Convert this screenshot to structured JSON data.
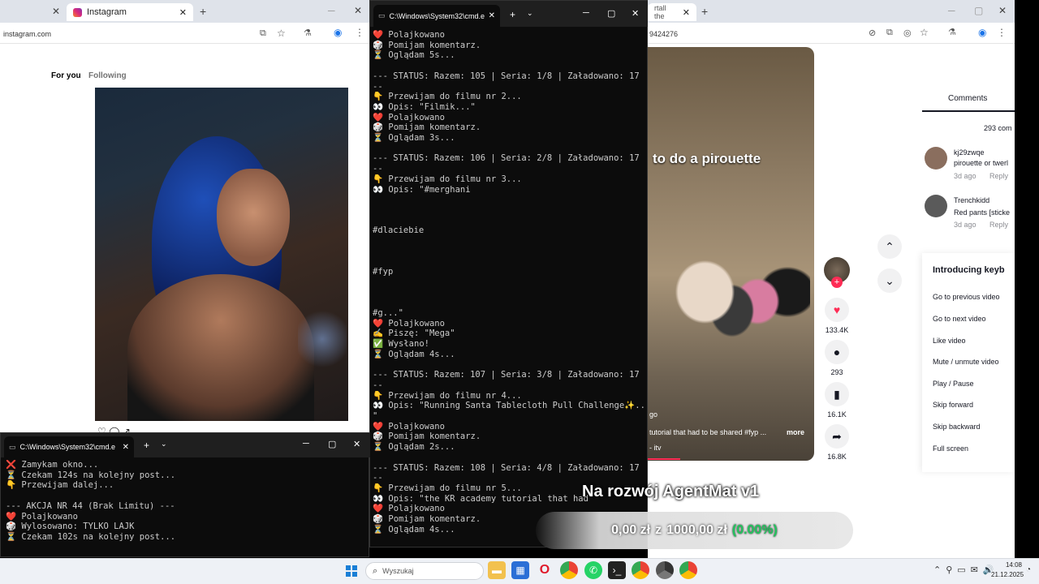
{
  "browser_left": {
    "tab_title": "Instagram",
    "url": "instagram.com",
    "feed_tabs": [
      "For you",
      "Following"
    ]
  },
  "browser_right": {
    "tab_title": "rtall the",
    "url": "9424276"
  },
  "tiktok": {
    "caption_overlay": "to do a pirouette",
    "desc": "tutorial that had to be shared #fyp ...",
    "more": "more",
    "desc_prefix": "go",
    "author": "- itv",
    "likes": "133.4K",
    "comments": "293",
    "saves": "16.1K",
    "shares": "16.8K",
    "comments_tab": "Comments",
    "comments_count": "293 com",
    "comment_list": [
      {
        "user": "kj29zwqe",
        "text": "pirouette or twerl",
        "date": "3d ago",
        "reply": "Reply"
      },
      {
        "user": "Trenchkidd",
        "text": "Red pants [sticke",
        "date": "3d ago",
        "reply": "Reply"
      }
    ],
    "kb_title": "Introducing keyb",
    "kb_items": [
      "Go to previous video",
      "Go to next video",
      "Like video",
      "Mute / unmute video",
      "Play / Pause",
      "Skip forward",
      "Skip backward",
      "Full screen"
    ]
  },
  "cmd_main": {
    "title": "C:\\Windows\\System32\\cmd.e",
    "output": "❤️ Polajkowano\n🎲 Pomijam komentarz.\n⏳ Oglądam 5s...\n\n--- STATUS: Razem: 105 | Seria: 1/8 | Załadowano: 17 -\n--\n👇 Przewijam do filmu nr 2...\n👀 Opis: \"Filmik...\"\n❤️ Polajkowano\n🎲 Pomijam komentarz.\n⏳ Oglądam 3s...\n\n--- STATUS: Razem: 106 | Seria: 2/8 | Załadowano: 17 -\n--\n👇 Przewijam do filmu nr 3...\n👀 Opis: \"#merghani\n\n\n\n#dlaciebie\n\n\n\n#fyp\n\n\n\n#g...\"\n❤️ Polajkowano\n✍️ Piszę: \"Mega\"\n✅ Wysłano!\n⏳ Oglądam 4s...\n\n--- STATUS: Razem: 107 | Seria: 3/8 | Załadowano: 17 -\n--\n👇 Przewijam do filmu nr 4...\n👀 Opis: \"Running Santa Tablecloth Pull Challenge✨...\n\"\n❤️ Polajkowano\n🎲 Pomijam komentarz.\n⏳ Oglądam 2s...\n\n--- STATUS: Razem: 108 | Seria: 4/8 | Załadowano: 17 -\n--\n👇 Przewijam do filmu nr 5...\n👀 Opis: \"the KR academy tutorial that had\n❤️ Polajkowano\n🎲 Pomijam komentarz.\n⏳ Oglądam 4s..."
  },
  "cmd_small": {
    "title": "C:\\Windows\\System32\\cmd.e",
    "output": "❌ Zamykam okno...\n⏳ Czekam 124s na kolejny post...\n👇 Przewijam dalej...\n\n--- AKCJA NR 44 (Brak Limitu) ---\n❤️ Polajkowano\n🎲 Wylosowano: TYLKO LAJK\n⏳ Czekam 102s na kolejny post..."
  },
  "overlay": {
    "headline": "Na rozwój AgentMat v1",
    "amount": "0,00 zł",
    "of": "z",
    "goal": "1000,00 zł",
    "pct": "(0.00%)"
  },
  "taskbar": {
    "search": "Wyszukaj",
    "time": "14:08",
    "date": "21.12.2025"
  },
  "colors": {
    "accent_pct": "#22c55e",
    "tiktok_like": "#fe2c55"
  }
}
